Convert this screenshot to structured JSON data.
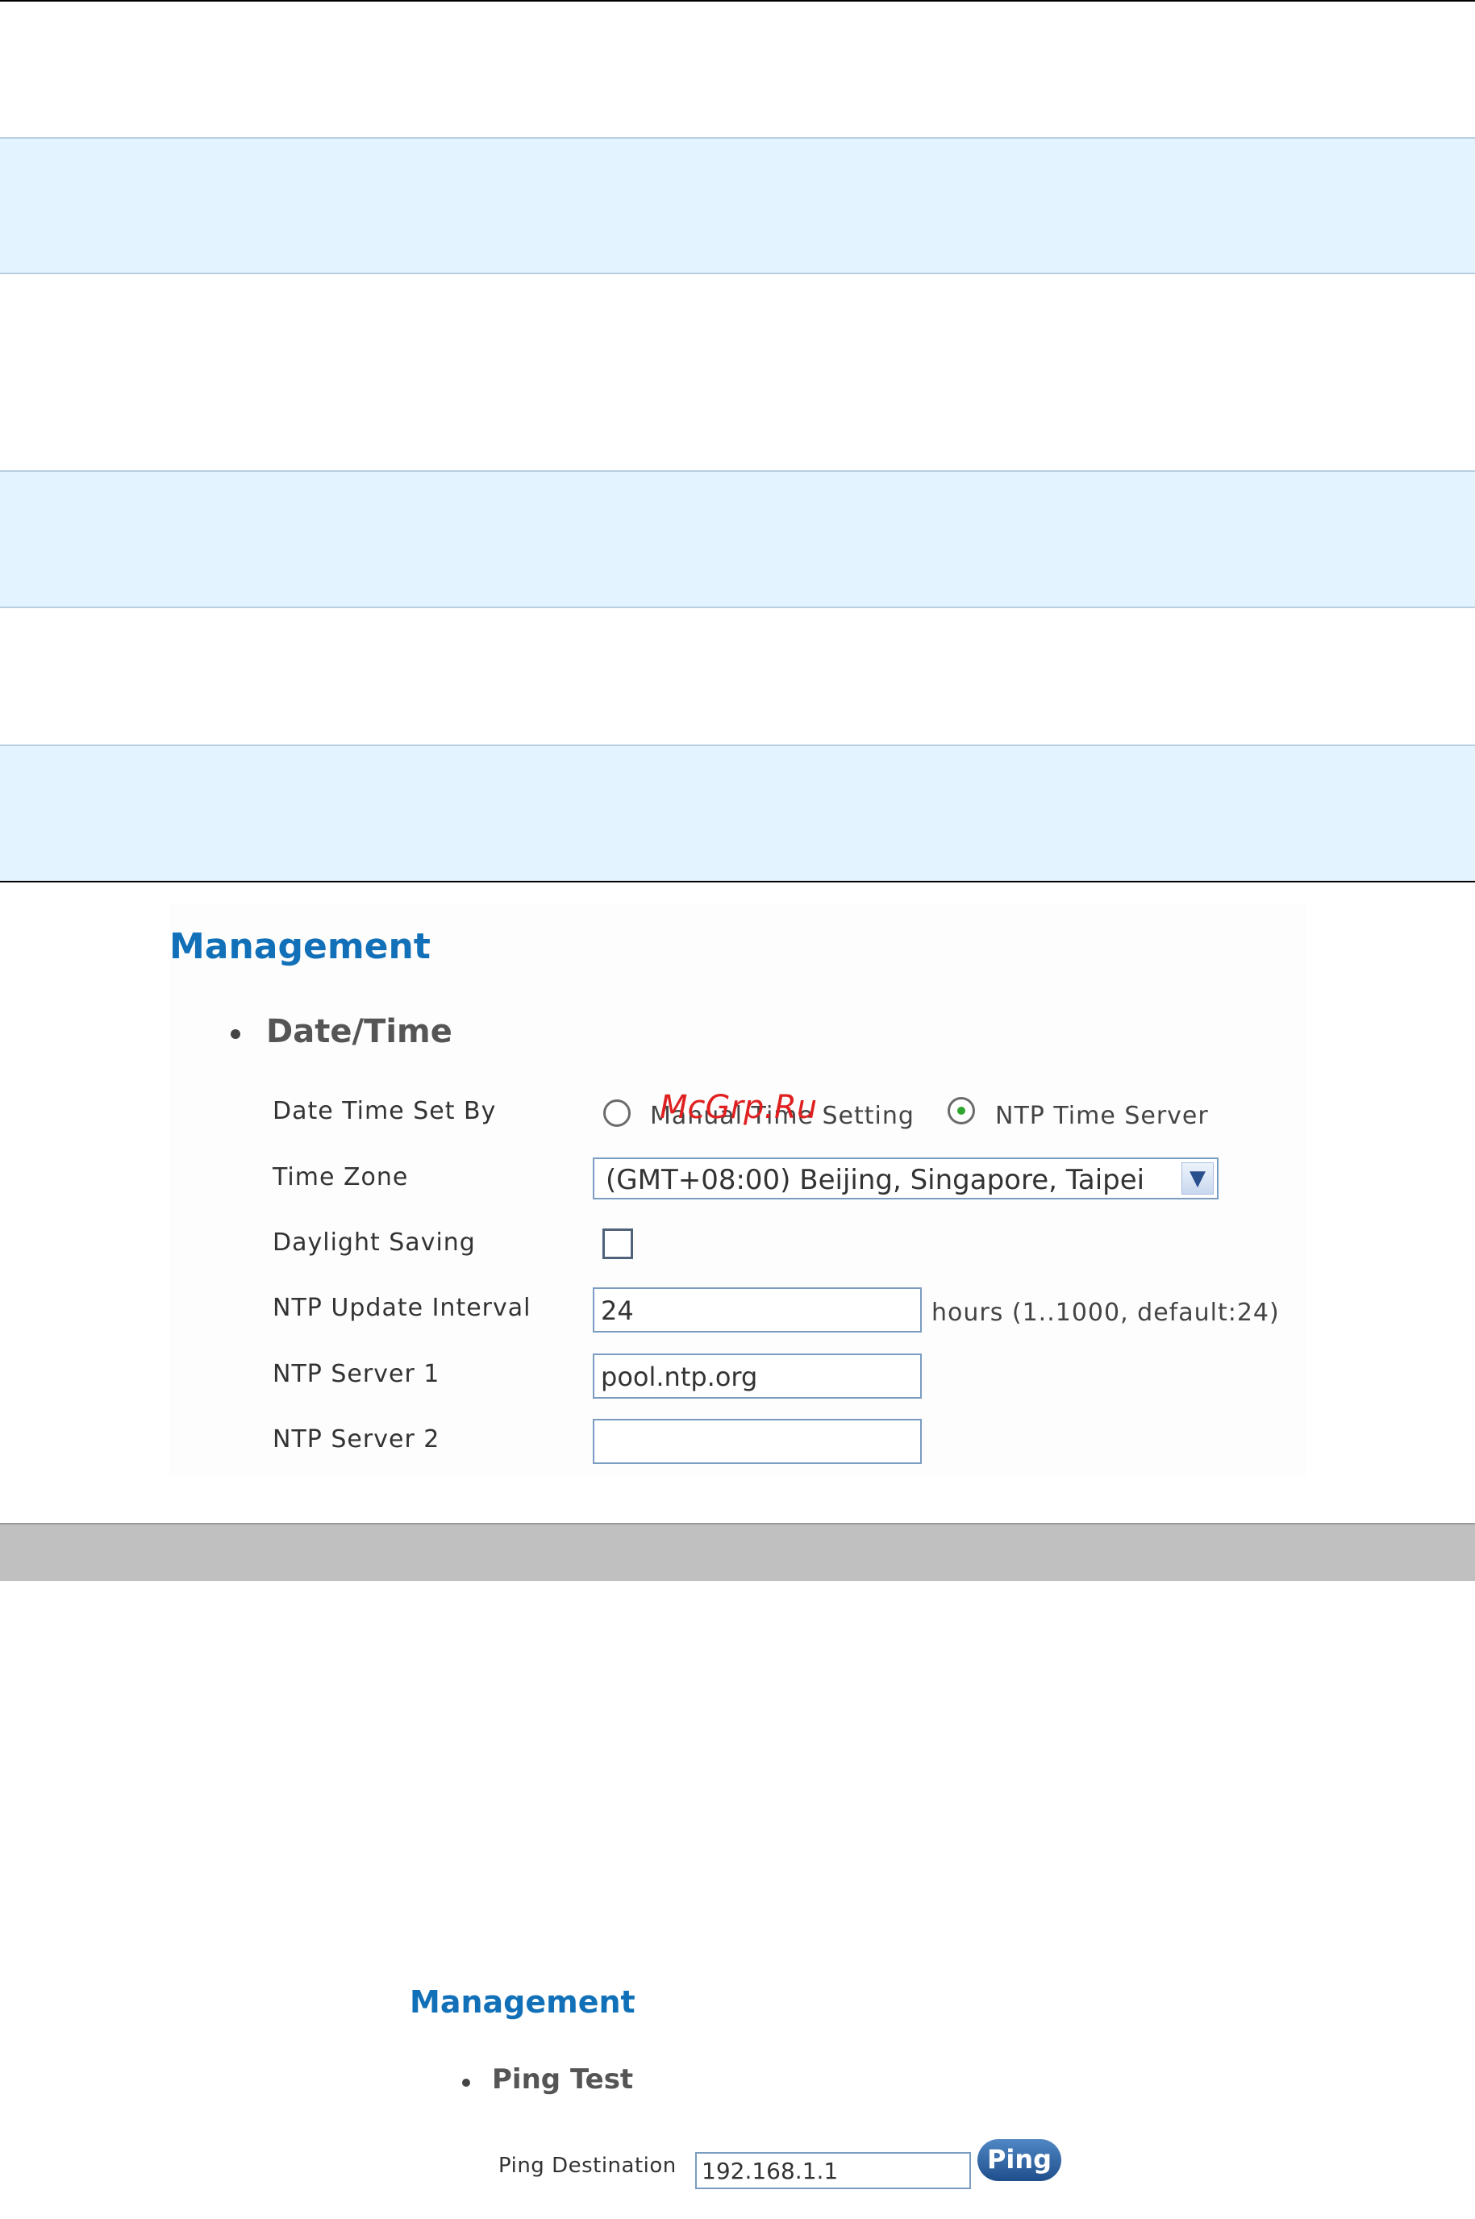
{
  "panel1": {
    "heading": "Management",
    "section": "Date/Time",
    "rows": {
      "set_by_label": "Date Time Set By",
      "time_zone_label": "Time Zone",
      "daylight_label": "Daylight Saving",
      "interval_label": "NTP Update Interval",
      "server1_label": "NTP Server 1",
      "server2_label": "NTP Server 2"
    },
    "set_by_options": {
      "manual": "Manual Time Setting",
      "ntp": "NTP Time Server",
      "selected": "ntp"
    },
    "time_zone_value": "(GMT+08:00) Beijing, Singapore, Taipei",
    "daylight_checked": false,
    "interval_value": "24",
    "interval_hint": "hours (1..1000, default:24)",
    "server1_value": "pool.ntp.org",
    "server2_value": ""
  },
  "watermark": "McGrp.Ru",
  "panel2": {
    "heading": "Management",
    "section": "Ping Test",
    "dest_label": "Ping Destination",
    "dest_value": "192.168.1.1",
    "ping_button": "Ping"
  },
  "icons": {
    "dropdown_arrow": "chevron-down-icon"
  },
  "colors": {
    "heading": "#1170b8",
    "band": "#e3f3ff",
    "grey_bar": "#c0c0c0",
    "radio_selected": "#2fa52f"
  }
}
